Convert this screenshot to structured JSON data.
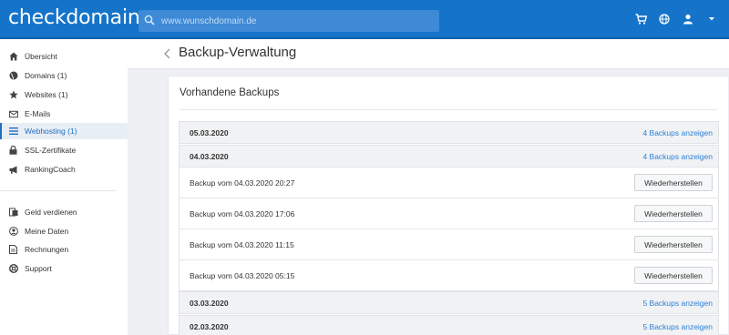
{
  "header": {
    "logo": "checkdomain",
    "search_placeholder": "www.wunschdomain.de",
    "icons": [
      "cart-icon",
      "globe-icon",
      "user-icon"
    ]
  },
  "sidebar": {
    "items": [
      {
        "label": "Übersicht",
        "icon": "home-icon"
      },
      {
        "label": "Domains (1)",
        "icon": "globe-icon"
      },
      {
        "label": "Websites (1)",
        "icon": "star-icon"
      },
      {
        "label": "E-Mails",
        "icon": "mail-icon"
      },
      {
        "label": "Webhosting (1)",
        "icon": "menu-icon",
        "active": true
      },
      {
        "label": "SSL-Zertifikate",
        "icon": "lock-icon"
      },
      {
        "label": "RankingCoach",
        "icon": "megaphone-icon"
      }
    ],
    "secondary_items": [
      {
        "label": "Geld verdienen",
        "icon": "money-icon"
      },
      {
        "label": "Meine Daten",
        "icon": "user-circle-icon"
      },
      {
        "label": "Rechnungen",
        "icon": "document-icon"
      },
      {
        "label": "Support",
        "icon": "lifebuoy-icon"
      }
    ]
  },
  "main": {
    "page_title": "Backup-Verwaltung",
    "card_title": "Vorhandene Backups",
    "groups": [
      {
        "date": "05.03.2020",
        "link": "4 Backups anzeigen"
      },
      {
        "date": "04.03.2020",
        "link": "4 Backups anzeigen"
      },
      {
        "date": "03.03.2020",
        "link": "5 Backups anzeigen"
      },
      {
        "date": "02.03.2020",
        "link": "5 Backups anzeigen"
      }
    ],
    "backups": [
      {
        "label": "Backup vom 04.03.2020 20:27",
        "button": "Wiederherstellen"
      },
      {
        "label": "Backup vom 04.03.2020 17:06",
        "button": "Wiederherstellen"
      },
      {
        "label": "Backup vom 04.03.2020 11:15",
        "button": "Wiederherstellen"
      },
      {
        "label": "Backup vom 04.03.2020 05:15",
        "button": "Wiederherstellen"
      }
    ]
  },
  "colors": {
    "brand": "#1574c9",
    "link": "#2b81d6",
    "active_nav": "#1e6fc3"
  }
}
